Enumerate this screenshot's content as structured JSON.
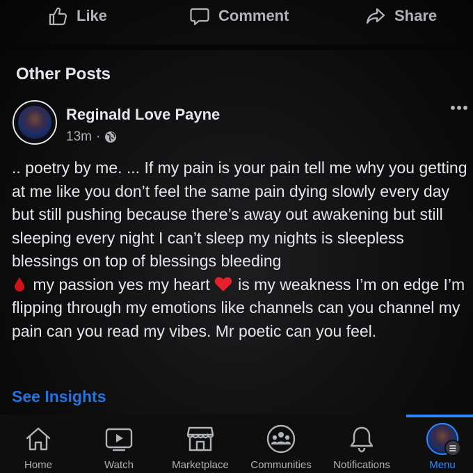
{
  "actions": {
    "like": "Like",
    "comment": "Comment",
    "share": "Share"
  },
  "section": {
    "title": "Other Posts"
  },
  "post": {
    "author": "Reginald Love Payne",
    "time": "13m",
    "separator": "·",
    "privacy_icon": "globe-icon",
    "text_part1": ".. poetry by me. ... If my pain is your pain tell me why you getting at me like you don’t feel the same pain dying slowly every day but still pushing because there’s away out awakening but still sleeping every night I can’t sleep my nights is sleepless blessings on top of blessings bleeding",
    "text_part2": "my passion yes my heart",
    "text_part3": "is my weakness I’m on edge I’m flipping through my emotions like channels can you channel my pain can you read my vibes. Mr poetic can you feel.",
    "emoji1": "drop-of-blood-icon",
    "emoji2": "red-heart-icon",
    "insights": "See Insights"
  },
  "nav": {
    "items": [
      {
        "label": "Home",
        "icon": "home-icon"
      },
      {
        "label": "Watch",
        "icon": "video-play-icon"
      },
      {
        "label": "Marketplace",
        "icon": "storefront-icon"
      },
      {
        "label": "Communities",
        "icon": "groups-icon"
      },
      {
        "label": "Notifications",
        "icon": "bell-icon"
      },
      {
        "label": "Menu",
        "icon": "profile-menu-icon"
      }
    ],
    "active": "Menu"
  },
  "colors": {
    "accent": "#2d88ff",
    "link": "#2374e1",
    "text": "#e4e6eb",
    "muted": "#b0b3b8",
    "background": "#0b0b0c"
  }
}
